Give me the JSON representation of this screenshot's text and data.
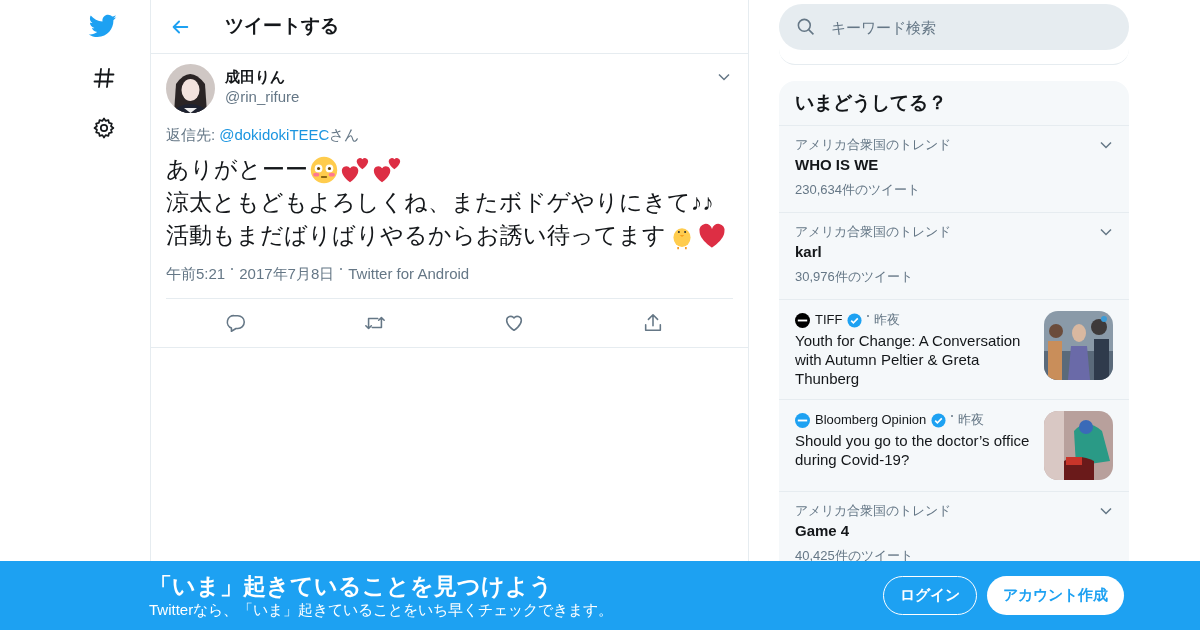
{
  "header": {
    "title": "ツイートする"
  },
  "tweet": {
    "author": "成田りん",
    "handle": "@rin_rifure",
    "reply_label": "返信先:",
    "reply_to": "@dokidokiTEEC",
    "reply_suffix": "さん",
    "lines": [
      [
        {
          "kind": "text",
          "text": "ありがとーー"
        },
        {
          "kind": "flushed"
        },
        {
          "kind": "hearts"
        },
        {
          "kind": "hearts"
        }
      ],
      [
        {
          "kind": "text",
          "text": "涼太ともどもよろしくね、またボドゲやりにきて♪♪"
        }
      ],
      [
        {
          "kind": "text",
          "text": "活動もまだばりばりやるからお誘い待ってます"
        },
        {
          "kind": "chick"
        },
        {
          "kind": "heart"
        }
      ]
    ],
    "meta": [
      "午前5:21",
      "2017年7月8日",
      "Twitter for Android"
    ]
  },
  "search": {
    "placeholder": "キーワード検索"
  },
  "trends_panel": {
    "title": "いまどうしてる？",
    "items": [
      {
        "kind": "trend",
        "context": "アメリカ合衆国のトレンド",
        "name": "WHO IS WE",
        "count": "230,634件のツイート"
      },
      {
        "kind": "trend",
        "context": "アメリカ合衆国のトレンド",
        "name": "karl",
        "count": "30,976件のツイート"
      },
      {
        "kind": "story",
        "source": "TIFF",
        "color": "#000000",
        "time": "昨夜",
        "headline": "Youth for Change: A Conversation with Autumn Peltier & Greta Thunberg"
      },
      {
        "kind": "story",
        "source": "Bloomberg Opinion",
        "color": "#1da1f2",
        "time": "昨夜",
        "headline": "Should you go to the doctor’s office during Covid-19?"
      },
      {
        "kind": "trend",
        "context": "アメリカ合衆国のトレンド",
        "name": "Game 4",
        "count": "40,425件のツイート"
      }
    ]
  },
  "banner": {
    "title": "「いま」起きていることを見つけよう",
    "subtitle": "Twitterなら、「いま」起きていることをいち早くチェックできます。",
    "buttons": [
      "ログイン",
      "アカウント作成"
    ]
  }
}
